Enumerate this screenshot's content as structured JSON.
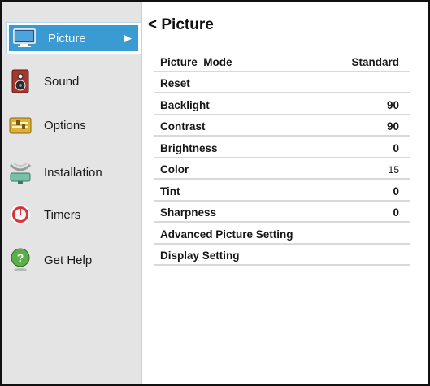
{
  "sidebar": {
    "items": [
      {
        "label": "Picture",
        "icon": "monitor-icon",
        "selected": true
      },
      {
        "label": "Sound",
        "icon": "speaker-icon",
        "selected": false
      },
      {
        "label": "Options",
        "icon": "options-icon",
        "selected": false
      },
      {
        "label": "Installation",
        "icon": "satellite-icon",
        "selected": false
      },
      {
        "label": "Timers",
        "icon": "timer-icon",
        "selected": false
      },
      {
        "label": "Get Help",
        "icon": "help-icon",
        "selected": false
      }
    ],
    "selected_arrow": "▶"
  },
  "main": {
    "title": "< Picture",
    "rows": [
      {
        "label": "Picture  Mode",
        "value": "Standard"
      },
      {
        "label": "Reset",
        "value": ""
      },
      {
        "label": "Backlight",
        "value": "90"
      },
      {
        "label": "Contrast",
        "value": "90"
      },
      {
        "label": "Brightness",
        "value": "0"
      },
      {
        "label": "Color",
        "value": "15"
      },
      {
        "label": "Tint",
        "value": "0"
      },
      {
        "label": "Sharpness",
        "value": "0"
      },
      {
        "label": "Advanced Picture Setting",
        "value": ""
      },
      {
        "label": "Display Setting",
        "value": ""
      }
    ]
  },
  "colors": {
    "selection": "#3a9bd3",
    "sidebar_bg": "#e4e4e4",
    "divider": "#d9d9d9"
  }
}
